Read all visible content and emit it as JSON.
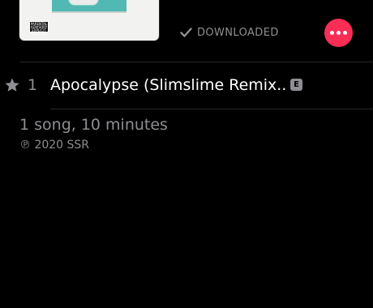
{
  "album": {
    "artwork_icon": "album-artwork",
    "advisory_label": "PARENTAL ADVISORY EXPLICIT CONTENT"
  },
  "header": {
    "downloaded_label": "DOWNLOADED",
    "check_icon": "check-icon",
    "more_icon": "more-icon",
    "accent_color": "#fa2d55"
  },
  "tracks": [
    {
      "number": "1",
      "title": "Apocalypse (Slimslime Remix...",
      "explicit_badge": "E",
      "star_icon": "star-icon"
    }
  ],
  "footer": {
    "summary": "1 song, 10 minutes",
    "copyright": "℗ 2020 SSR"
  }
}
